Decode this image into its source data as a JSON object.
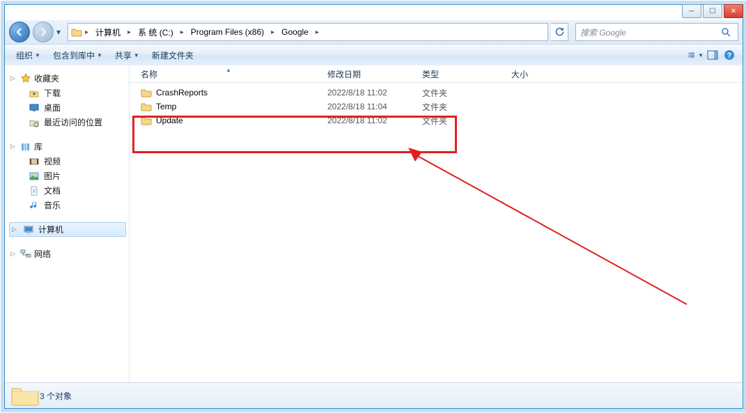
{
  "window_controls": {
    "min": "—",
    "max": "☐",
    "close": "✕"
  },
  "breadcrumbs": [
    "计算机",
    "系 统 (C:)",
    "Program Files (x86)",
    "Google"
  ],
  "search": {
    "placeholder": "搜索 Google"
  },
  "toolbar": {
    "organize": "组织",
    "include": "包含到库中",
    "share": "共享",
    "newfolder": "新建文件夹"
  },
  "sidebar": {
    "favorites": {
      "label": "收藏夹",
      "items": [
        "下载",
        "桌面",
        "最近访问的位置"
      ]
    },
    "libraries": {
      "label": "库",
      "items": [
        "视频",
        "图片",
        "文档",
        "音乐"
      ]
    },
    "computer": {
      "label": "计算机"
    },
    "network": {
      "label": "网络"
    }
  },
  "columns": {
    "name": "名称",
    "date": "修改日期",
    "type": "类型",
    "size": "大小"
  },
  "rows": [
    {
      "name": "CrashReports",
      "date": "2022/8/18 11:02",
      "type": "文件夹"
    },
    {
      "name": "Temp",
      "date": "2022/8/18 11:04",
      "type": "文件夹"
    },
    {
      "name": "Update",
      "date": "2022/8/18 11:02",
      "type": "文件夹"
    }
  ],
  "status": {
    "text": "3 个对象"
  }
}
